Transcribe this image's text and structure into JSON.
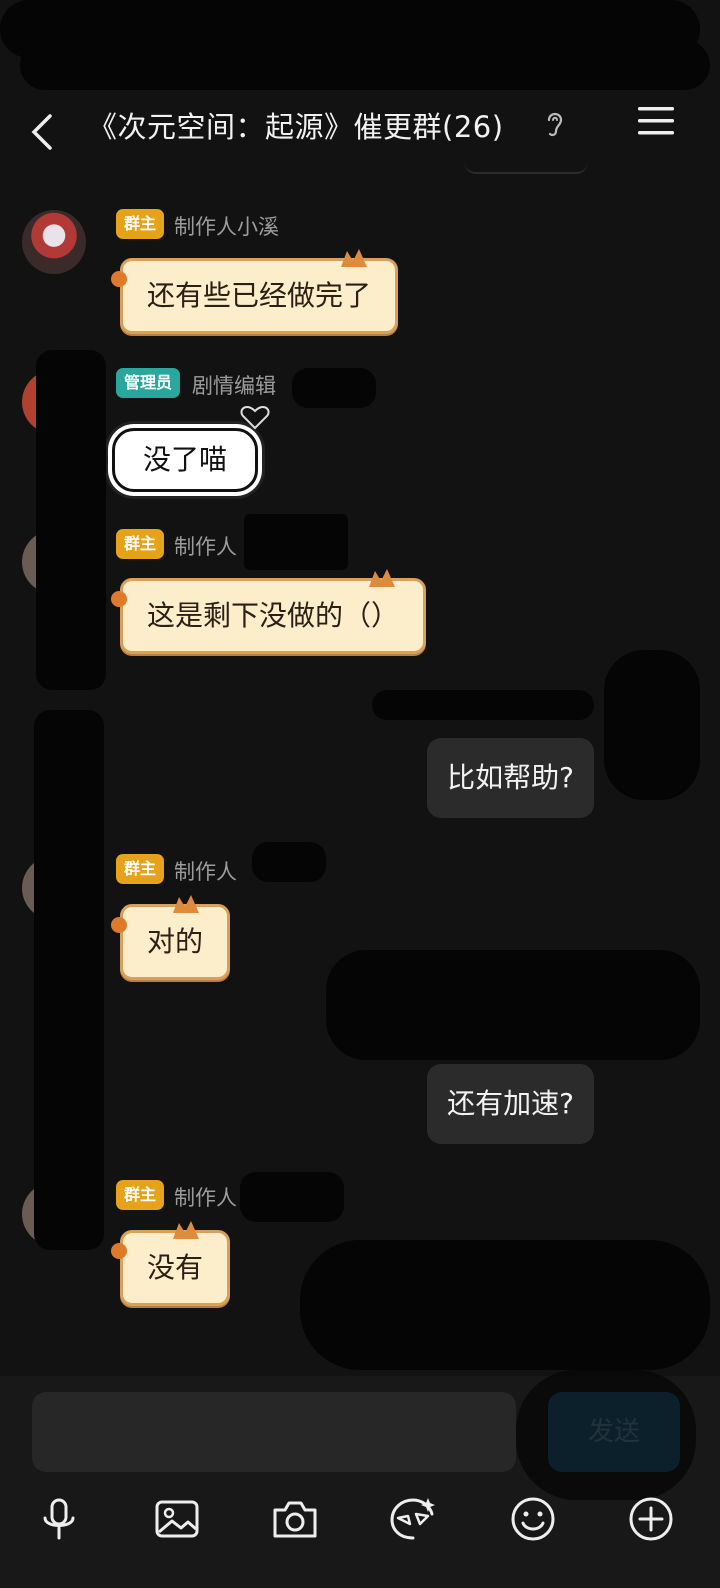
{
  "header": {
    "title": "《次元空间：起源》催更群(26)",
    "back_icon": "back-arrow-icon",
    "ear_icon": "ear-icon",
    "menu_icon": "menu-icon"
  },
  "messages": [
    {
      "role": "群主",
      "sender": "制作人小溪",
      "text": "还有些已经做完了"
    },
    {
      "role": "管理员",
      "sender": "剧情编辑",
      "text": "没了喵"
    },
    {
      "role": "群主",
      "sender": "制作人",
      "text": "这是剩下没做的（）"
    },
    {
      "self": true,
      "text": "比如帮助?"
    },
    {
      "role": "群主",
      "sender": "制作人",
      "text": "对的"
    },
    {
      "self": true,
      "text": "还有加速?"
    },
    {
      "role": "群主",
      "sender": "制作人",
      "text": "没有"
    }
  ],
  "input": {
    "placeholder": "",
    "send_label": "发送"
  },
  "toolbar": {
    "icons": [
      "microphone-icon",
      "image-icon",
      "camera-icon",
      "sticker-icon",
      "emoji-icon",
      "plus-icon"
    ]
  },
  "colors": {
    "background": "#121212",
    "owner_badge": "#e5a21a",
    "admin_badge": "#2aa79c",
    "cat_bubble": "#fdeecb",
    "self_bubble": "#2b2b2b",
    "send_button": "#1e6f9c"
  }
}
